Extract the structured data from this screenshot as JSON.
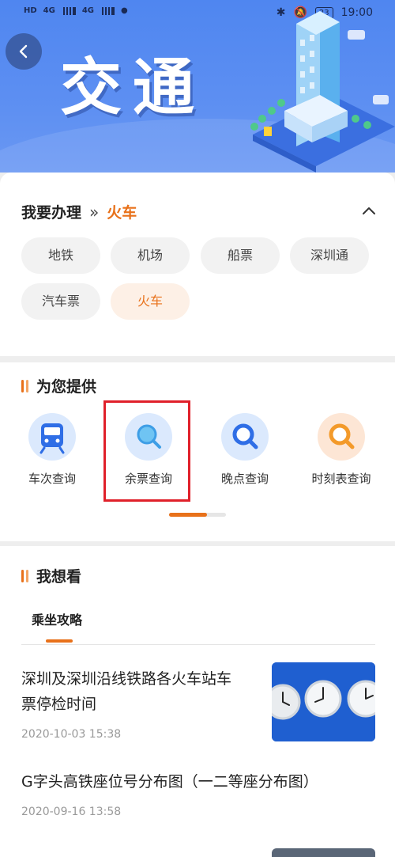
{
  "status_bar": {
    "left_labels": [
      "HD",
      "4G",
      "4G"
    ],
    "battery": "23",
    "time": "19:00"
  },
  "header": {
    "title": "交通",
    "back_icon": "back-arrow-icon"
  },
  "handle_section": {
    "title": "我要办理",
    "separator": "»",
    "current": "火车",
    "chips": [
      {
        "label": "地铁",
        "active": false
      },
      {
        "label": "机场",
        "active": false
      },
      {
        "label": "船票",
        "active": false
      },
      {
        "label": "深圳通",
        "active": false
      },
      {
        "label": "汽车票",
        "active": false
      },
      {
        "label": "火车",
        "active": true
      }
    ]
  },
  "services_section": {
    "title": "为您提供",
    "items": [
      {
        "label": "车次查询",
        "icon": "train-icon"
      },
      {
        "label": "余票查询",
        "icon": "search-icon"
      },
      {
        "label": "晚点查询",
        "icon": "search-icon"
      },
      {
        "label": "时刻表查询",
        "icon": "search-icon"
      }
    ]
  },
  "watch_section": {
    "title": "我想看",
    "tab": "乘坐攻略",
    "articles": [
      {
        "title_line1": "深圳及深圳沿线铁路各火车站车",
        "title_line2": "票停检时间",
        "date": "2020-10-03 15:38"
      },
      {
        "title_line1": "G字头高铁座位号分布图（一二等座分布图）",
        "title_line2": "",
        "date": "2020-09-16 13:58"
      }
    ]
  },
  "colors": {
    "accent": "#e8711a",
    "banner": "#5a8cf2",
    "highlight": "#e0202a"
  }
}
